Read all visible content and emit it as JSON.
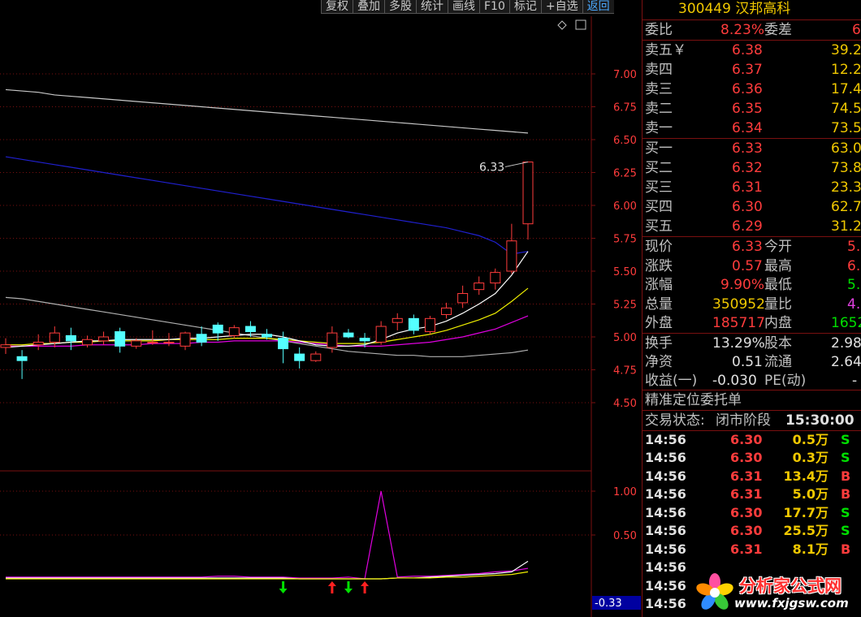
{
  "toolbar": {
    "buttons": [
      "复权",
      "叠加",
      "多股",
      "统计",
      "画线",
      "F10",
      "标记",
      "+自选",
      "返回"
    ]
  },
  "chart_icons": [
    "diamond-icon",
    "window-icon"
  ],
  "main_chart": {
    "y_ticks": [
      "7.00",
      "6.75",
      "6.50",
      "6.25",
      "6.00",
      "5.75",
      "5.50",
      "5.25",
      "5.00",
      "4.75",
      "4.50"
    ],
    "price_label": "6.33"
  },
  "sub_chart": {
    "y_ticks": [
      "1.00",
      "0.50"
    ],
    "value_box": "-0.33"
  },
  "stock": {
    "code": "300449",
    "name": "汉邦高科"
  },
  "order_ratio": {
    "label": "委比",
    "value": "8.23%",
    "diff_label": "委差",
    "diff_value": "6"
  },
  "asks": [
    {
      "label": "卖五￥",
      "price": "6.38",
      "vol": "39.2"
    },
    {
      "label": "卖四",
      "price": "6.37",
      "vol": "12.2"
    },
    {
      "label": "卖三",
      "price": "6.36",
      "vol": "17.4"
    },
    {
      "label": "卖二",
      "price": "6.35",
      "vol": "74.5"
    },
    {
      "label": "卖一",
      "price": "6.34",
      "vol": "73.5"
    }
  ],
  "bids": [
    {
      "label": "买一",
      "price": "6.33",
      "vol": "63.0"
    },
    {
      "label": "买二",
      "price": "6.32",
      "vol": "73.8"
    },
    {
      "label": "买三",
      "price": "6.31",
      "vol": "23.3"
    },
    {
      "label": "买四",
      "price": "6.30",
      "vol": "62.7"
    },
    {
      "label": "买五",
      "price": "6.29",
      "vol": "31.2"
    }
  ],
  "quote": [
    {
      "l1": "现价",
      "v1": "6.33",
      "c1": "red",
      "l2": "今开",
      "v2": "5.",
      "c2": "red"
    },
    {
      "l1": "涨跌",
      "v1": "0.57",
      "c1": "red",
      "l2": "最高",
      "v2": "6.",
      "c2": "red"
    },
    {
      "l1": "涨幅",
      "v1": "9.90%",
      "c1": "red",
      "l2": "最低",
      "v2": "5.",
      "c2": "green"
    },
    {
      "l1": "总量",
      "v1": "350952",
      "c1": "yellow",
      "l2": "量比",
      "v2": "4.",
      "c2": "mag"
    },
    {
      "l1": "外盘",
      "v1": "185717",
      "c1": "red",
      "l2": "内盘",
      "v2": "1652",
      "c2": "green"
    }
  ],
  "fundamentals": [
    {
      "l1": "换手",
      "v1": "13.29%",
      "l2": "股本",
      "v2": "2.98"
    },
    {
      "l1": "净资",
      "v1": "0.51",
      "l2": "流通",
      "v2": "2.64"
    },
    {
      "l1": "收益(一)",
      "v1": "-0.030",
      "l2": "PE(动)",
      "v2": "-"
    }
  ],
  "precise_order_title": "精准定位委托单",
  "trade_status": {
    "label": "交易状态:",
    "value": "闭市阶段",
    "time": "15:30:00"
  },
  "ticks": [
    {
      "time": "14:56",
      "price": "6.30",
      "vol": "0.5万",
      "side": "S"
    },
    {
      "time": "14:56",
      "price": "6.30",
      "vol": "0.3万",
      "side": "S"
    },
    {
      "time": "14:56",
      "price": "6.31",
      "vol": "13.4万",
      "side": "B"
    },
    {
      "time": "14:56",
      "price": "6.31",
      "vol": "5.0万",
      "side": "B"
    },
    {
      "time": "14:56",
      "price": "6.30",
      "vol": "17.7万",
      "side": "S"
    },
    {
      "time": "14:56",
      "price": "6.30",
      "vol": "25.5万",
      "side": "S"
    },
    {
      "time": "14:56",
      "price": "6.31",
      "vol": "8.1万",
      "side": "B"
    },
    {
      "time": "14:56",
      "price": "",
      "vol": "",
      "side": ""
    },
    {
      "time": "14:56",
      "price": "",
      "vol": "",
      "side": ""
    },
    {
      "time": "14:56",
      "price": "",
      "vol": "",
      "side": ""
    }
  ],
  "watermark": {
    "title": "分析家公式网",
    "url": "www.fxjgsw.com"
  },
  "colors": {
    "up": "#ff3c3c",
    "down": "#54ffff",
    "grid_red": "#7a1010",
    "ma_white": "#c8c8c8",
    "ma_yellow": "#f0f000",
    "ma_magenta": "#e000e0",
    "ma_blue": "#2020d0",
    "ma_gray": "#b0b0b0"
  },
  "chart_data": [
    {
      "type": "candlestick",
      "ylim": [
        4.5,
        7.0
      ],
      "candles": [
        {
          "o": 4.92,
          "h": 4.99,
          "l": 4.87,
          "c": 4.94
        },
        {
          "o": 4.85,
          "h": 4.9,
          "l": 4.68,
          "c": 4.82
        },
        {
          "o": 4.94,
          "h": 5.02,
          "l": 4.9,
          "c": 4.96
        },
        {
          "o": 4.96,
          "h": 5.08,
          "l": 4.92,
          "c": 5.03
        },
        {
          "o": 5.01,
          "h": 5.07,
          "l": 4.9,
          "c": 4.97
        },
        {
          "o": 4.94,
          "h": 5.01,
          "l": 4.92,
          "c": 4.98
        },
        {
          "o": 4.97,
          "h": 5.04,
          "l": 4.94,
          "c": 5.0
        },
        {
          "o": 5.04,
          "h": 5.07,
          "l": 4.88,
          "c": 4.93
        },
        {
          "o": 4.93,
          "h": 4.99,
          "l": 4.91,
          "c": 4.97
        },
        {
          "o": 4.96,
          "h": 5.05,
          "l": 4.94,
          "c": 4.96
        },
        {
          "o": 4.96,
          "h": 5.03,
          "l": 4.93,
          "c": 4.96
        },
        {
          "o": 4.93,
          "h": 5.04,
          "l": 4.9,
          "c": 5.03
        },
        {
          "o": 5.02,
          "h": 5.08,
          "l": 4.93,
          "c": 4.96
        },
        {
          "o": 5.09,
          "h": 5.11,
          "l": 4.97,
          "c": 5.03
        },
        {
          "o": 5.01,
          "h": 5.09,
          "l": 4.99,
          "c": 5.07
        },
        {
          "o": 5.08,
          "h": 5.12,
          "l": 5.0,
          "c": 5.04
        },
        {
          "o": 5.02,
          "h": 5.06,
          "l": 4.98,
          "c": 5.0
        },
        {
          "o": 4.99,
          "h": 5.04,
          "l": 4.8,
          "c": 4.91
        },
        {
          "o": 4.87,
          "h": 4.92,
          "l": 4.76,
          "c": 4.82
        },
        {
          "o": 4.82,
          "h": 4.89,
          "l": 4.81,
          "c": 4.87
        },
        {
          "o": 4.92,
          "h": 5.08,
          "l": 4.88,
          "c": 5.03
        },
        {
          "o": 5.03,
          "h": 5.06,
          "l": 4.99,
          "c": 5.0
        },
        {
          "o": 4.99,
          "h": 5.03,
          "l": 4.92,
          "c": 4.97
        },
        {
          "o": 4.96,
          "h": 5.12,
          "l": 4.94,
          "c": 5.08
        },
        {
          "o": 5.11,
          "h": 5.18,
          "l": 5.05,
          "c": 5.14
        },
        {
          "o": 5.14,
          "h": 5.17,
          "l": 5.02,
          "c": 5.05
        },
        {
          "o": 5.04,
          "h": 5.16,
          "l": 5.02,
          "c": 5.14
        },
        {
          "o": 5.17,
          "h": 5.26,
          "l": 5.14,
          "c": 5.22
        },
        {
          "o": 5.26,
          "h": 5.39,
          "l": 5.22,
          "c": 5.33
        },
        {
          "o": 5.36,
          "h": 5.46,
          "l": 5.32,
          "c": 5.41
        },
        {
          "o": 5.41,
          "h": 5.52,
          "l": 5.36,
          "c": 5.49
        },
        {
          "o": 5.5,
          "h": 5.86,
          "l": 5.48,
          "c": 5.73
        },
        {
          "o": 5.86,
          "h": 6.33,
          "l": 5.74,
          "c": 6.33
        }
      ],
      "ma_white": [
        4.92,
        4.93,
        4.94,
        4.95,
        4.96,
        4.97,
        4.97,
        4.98,
        4.98,
        4.98,
        4.98,
        4.99,
        4.99,
        5.0,
        5.01,
        5.02,
        5.02,
        5.0,
        4.97,
        4.94,
        4.93,
        4.93,
        4.94,
        4.98,
        5.03,
        5.06,
        5.08,
        5.12,
        5.18,
        5.25,
        5.33,
        5.47,
        5.65
      ],
      "ma_yellow": [
        4.94,
        4.94,
        4.95,
        4.95,
        4.96,
        4.96,
        4.97,
        4.97,
        4.97,
        4.97,
        4.98,
        4.98,
        4.98,
        4.98,
        4.99,
        4.99,
        4.99,
        4.98,
        4.97,
        4.96,
        4.95,
        4.95,
        4.95,
        4.96,
        4.98,
        5.0,
        5.02,
        5.05,
        5.09,
        5.13,
        5.18,
        5.27,
        5.37
      ],
      "ma_magenta": [
        4.93,
        4.93,
        4.93,
        4.93,
        4.93,
        4.94,
        4.94,
        4.94,
        4.94,
        4.95,
        4.95,
        4.95,
        4.96,
        4.96,
        4.97,
        4.97,
        4.97,
        4.97,
        4.96,
        4.95,
        4.94,
        4.93,
        4.93,
        4.93,
        4.94,
        4.95,
        4.96,
        4.98,
        5.0,
        5.03,
        5.06,
        5.11,
        5.16
      ],
      "ma_gray": [
        5.3,
        5.29,
        5.27,
        5.25,
        5.23,
        5.21,
        5.19,
        5.17,
        5.15,
        5.13,
        5.11,
        5.09,
        5.07,
        5.05,
        5.03,
        5.01,
        4.99,
        4.97,
        4.95,
        4.93,
        4.91,
        4.89,
        4.88,
        4.87,
        4.86,
        4.86,
        4.85,
        4.85,
        4.85,
        4.86,
        4.87,
        4.88,
        4.9
      ],
      "ma_blue": [
        6.37,
        6.35,
        6.33,
        6.31,
        6.29,
        6.27,
        6.25,
        6.23,
        6.21,
        6.19,
        6.17,
        6.15,
        6.13,
        6.11,
        6.09,
        6.07,
        6.05,
        6.03,
        6.01,
        5.99,
        5.97,
        5.95,
        5.93,
        5.91,
        5.89,
        5.87,
        5.85,
        5.83,
        5.8,
        5.77,
        5.72,
        5.63,
        5.65
      ],
      "ma_top_white": [
        6.88,
        6.87,
        6.86,
        6.84,
        6.83,
        6.82,
        6.81,
        6.8,
        6.79,
        6.78,
        6.77,
        6.76,
        6.75,
        6.74,
        6.73,
        6.72,
        6.71,
        6.7,
        6.69,
        6.68,
        6.67,
        6.66,
        6.65,
        6.64,
        6.63,
        6.62,
        6.61,
        6.6,
        6.59,
        6.58,
        6.57,
        6.56,
        6.55
      ]
    },
    {
      "type": "line",
      "ylim": [
        0,
        1.0
      ],
      "series": [
        {
          "values": [
            0.02,
            0.02,
            0.02,
            0.02,
            0.02,
            0.02,
            0.02,
            0.02,
            0.02,
            0.02,
            0.02,
            0.02,
            0.02,
            0.03,
            0.03,
            0.02,
            0.02,
            0.02,
            0.01,
            0.01,
            0.01,
            0.02,
            0.0,
            1.0,
            0.02,
            0.03,
            0.03,
            0.04,
            0.05,
            0.06,
            0.08,
            0.09,
            0.12
          ]
        },
        {
          "values": [
            0.01,
            0.01,
            0.01,
            0.01,
            0.01,
            0.01,
            0.01,
            0.01,
            0.01,
            0.01,
            0.01,
            0.01,
            0.01,
            0.01,
            0.01,
            0.01,
            0.01,
            0.01,
            0.0,
            0.0,
            0.0,
            0.0,
            0.0,
            0.0,
            0.01,
            0.01,
            0.02,
            0.03,
            0.04,
            0.05,
            0.06,
            0.08,
            0.2
          ]
        },
        {
          "values": [
            0.0,
            0.0,
            0.0,
            0.0,
            0.0,
            0.0,
            0.0,
            0.0,
            0.0,
            0.0,
            0.0,
            0.0,
            0.0,
            0.0,
            0.0,
            0.0,
            0.0,
            0.0,
            0.0,
            0.0,
            0.0,
            0.0,
            0.0,
            0.0,
            0.01,
            0.01,
            0.01,
            0.02,
            0.02,
            0.03,
            0.04,
            0.05,
            0.08
          ]
        }
      ],
      "arrows": [
        {
          "index": 17,
          "dir": "down"
        },
        {
          "index": 20,
          "dir": "up"
        },
        {
          "index": 21,
          "dir": "down"
        },
        {
          "index": 22,
          "dir": "up"
        }
      ]
    }
  ]
}
